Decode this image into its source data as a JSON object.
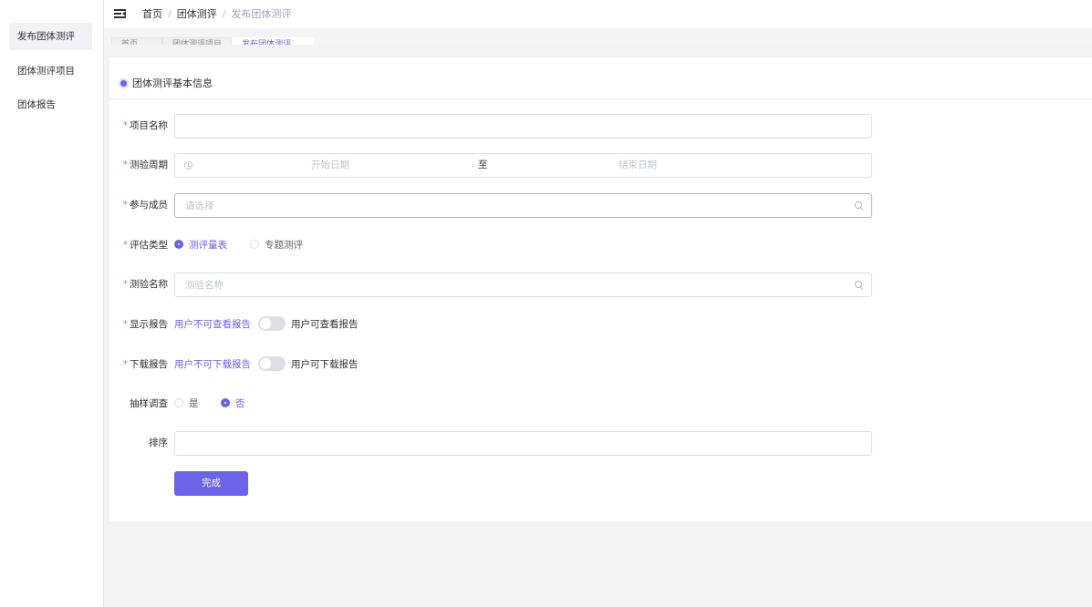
{
  "sidebar": {
    "items": [
      {
        "label": "发布团体测评",
        "active": true
      },
      {
        "label": "团体测评项目",
        "active": false
      },
      {
        "label": "团体报告",
        "active": false
      }
    ]
  },
  "header": {
    "menu_icon": "menu-fold-icon",
    "breadcrumb": [
      "首页",
      "团体测评",
      "发布团体测评"
    ]
  },
  "tags": [
    "首页",
    "团体测评项目",
    "发布团体测评"
  ],
  "form": {
    "section_title": "团体测评基本信息",
    "project_name": {
      "label": "项目名称",
      "required": true,
      "value": ""
    },
    "period": {
      "label": "测验周期",
      "required": true,
      "start_placeholder": "开始日期",
      "separator": "至",
      "end_placeholder": "结束日期"
    },
    "members": {
      "label": "参与成员",
      "required": true,
      "placeholder": "请选择"
    },
    "eval_type": {
      "label": "评估类型",
      "required": true,
      "options": [
        "测评量表",
        "专题测评"
      ],
      "selected": "测评量表"
    },
    "test_name": {
      "label": "测验名称",
      "required": true,
      "placeholder": "测验名称"
    },
    "show_report": {
      "label": "显示报告",
      "required": true,
      "inactive_text": "用户不可查看报告",
      "active_text": "用户可查看报告",
      "on": false
    },
    "download_report": {
      "label": "下载报告",
      "required": true,
      "inactive_text": "用户不可下载报告",
      "active_text": "用户可下载报告",
      "on": false
    },
    "sampling": {
      "label": "抽样调查",
      "required": false,
      "options": [
        "是",
        "否"
      ],
      "selected": "否"
    },
    "sort": {
      "label": "排序",
      "required": false,
      "value": ""
    },
    "submit_label": "完成"
  },
  "colors": {
    "primary": "#6d62ea",
    "required": "#f56c6c",
    "background": "#f3f3f4"
  }
}
